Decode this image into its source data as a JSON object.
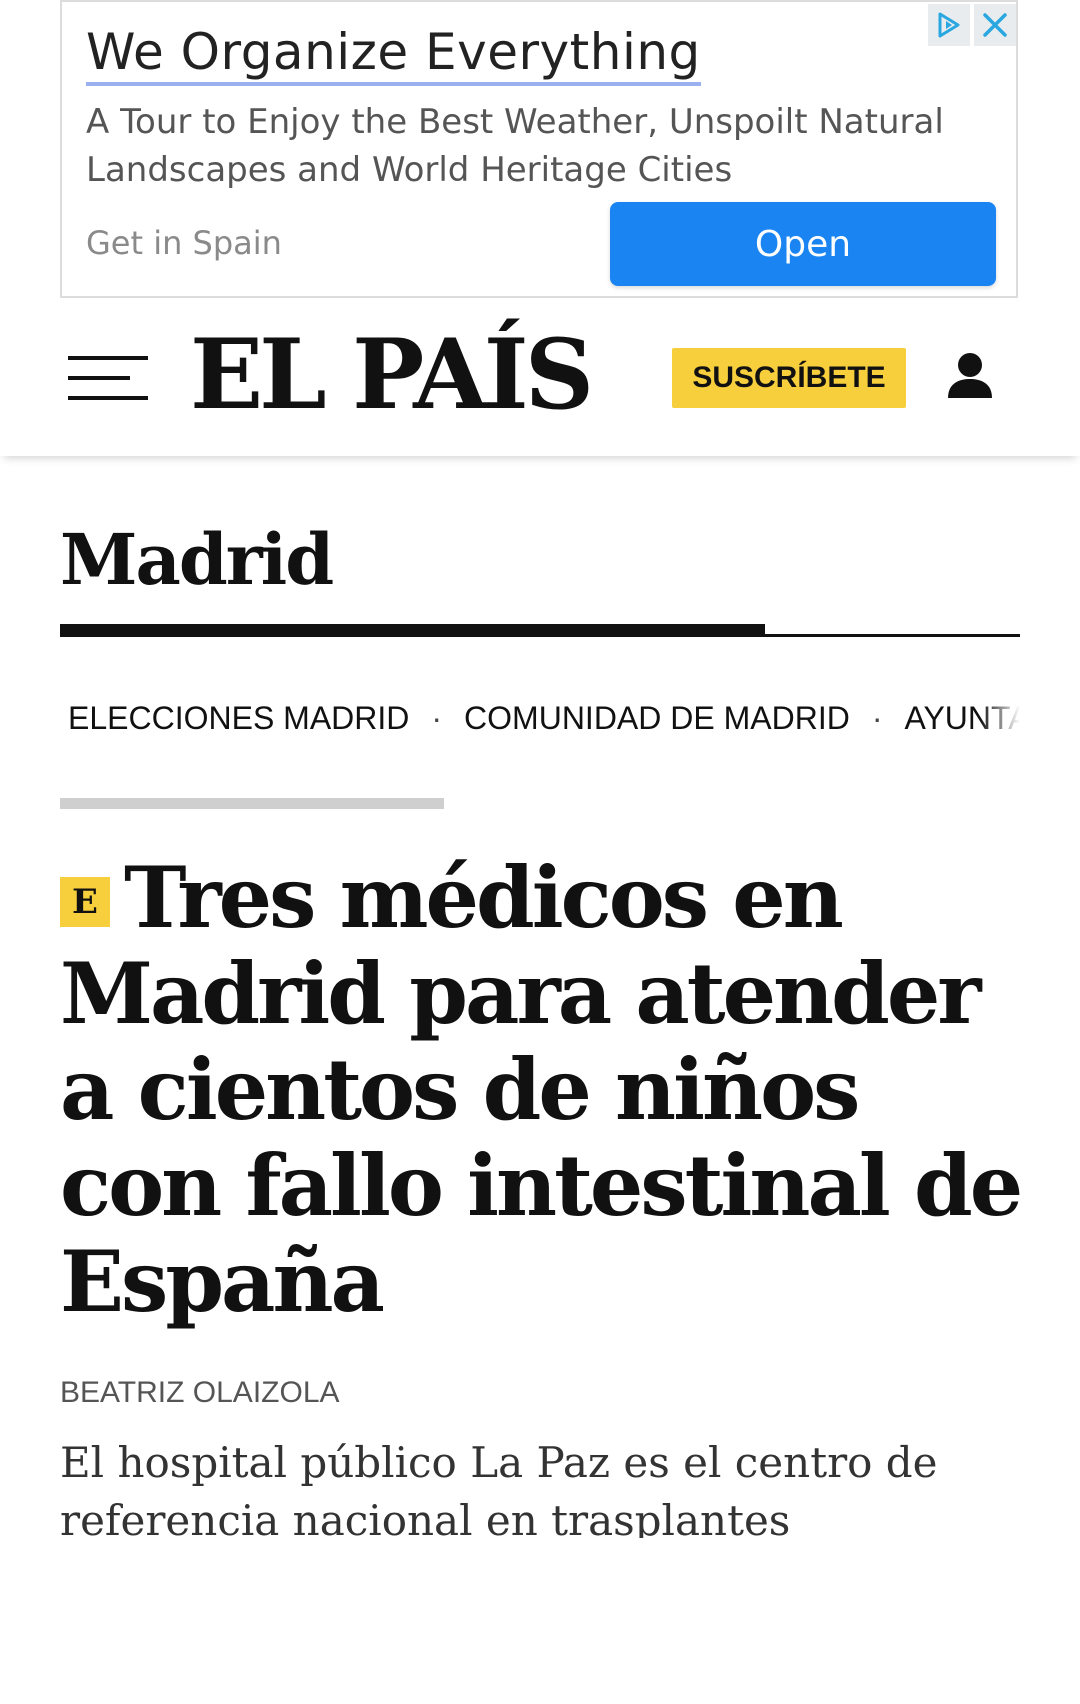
{
  "ad": {
    "title": "We Organize Everything",
    "description": "A Tour to Enjoy the Best Weather, Unspoilt Natural Landscapes and World Heritage Cities",
    "source": "Get in Spain",
    "open_label": "Open",
    "adchoices_icon": "adchoices-icon",
    "close_icon": "close-icon",
    "button_color": "#1a84f2"
  },
  "header": {
    "menu_icon": "hamburger-menu-icon",
    "logo": "EL PAÍS",
    "subscribe_label": "SUSCRÍBETE",
    "subscribe_color": "#f7cf3d",
    "user_icon": "user-icon"
  },
  "section": {
    "title": "Madrid",
    "subnav": [
      "ELECCIONES MADRID",
      "COMUNIDAD DE MADRID",
      "AYUNTAMIENTO"
    ],
    "separator": "·"
  },
  "article": {
    "badge": "E",
    "headline": "Tres médicos en Madrid para atender a cientos de niños con fallo intestinal de España",
    "author": "BEATRIZ OLAIZOLA",
    "summary": "El hospital público La Paz es el centro de referencia nacional en trasplantes intestinales"
  }
}
